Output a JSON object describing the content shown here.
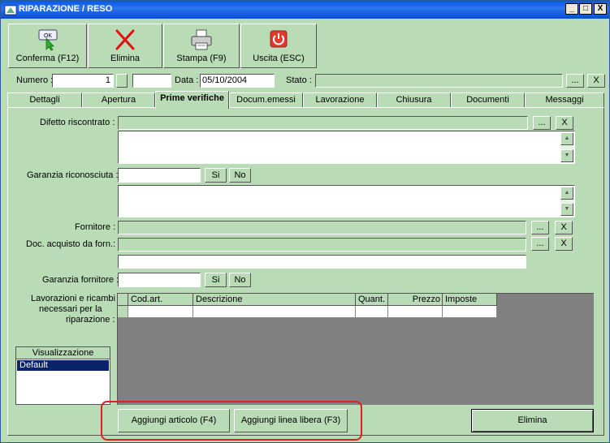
{
  "window": {
    "title": "RIPARAZIONE / RESO",
    "minimize": "_",
    "maximize": "□",
    "close": "X"
  },
  "toolbar": [
    {
      "label": "Conferma (F12)",
      "icon": "ok-cursor-icon"
    },
    {
      "label": "Elimina",
      "icon": "red-x-icon"
    },
    {
      "label": "Stampa (F9)",
      "icon": "printer-icon"
    },
    {
      "label": "Uscita (ESC)",
      "icon": "power-icon"
    }
  ],
  "header": {
    "numero_label": "Numero :",
    "numero_value": "1",
    "data_label": "Data :",
    "data_value": "05/10/2004",
    "stato_label": "Stato :",
    "lookup": "...",
    "clear": "X"
  },
  "tabs": [
    "Dettagli",
    "Apertura",
    "Prime verifiche",
    "Docum.emessi",
    "Lavorazione",
    "Chiusura",
    "Documenti",
    "Messaggi"
  ],
  "active_tab": "Prime verifiche",
  "form": {
    "difetto_label": "Difetto riscontrato :",
    "garanzia_label": "Garanzia riconosciuta :",
    "si": "Si",
    "no": "No",
    "fornitore_label": "Fornitore :",
    "doc_acquisto_label": "Doc. acquisto da forn.:",
    "garanzia_fornitore_label": "Garanzia fornitore :",
    "lavorazioni_label_1": "Lavorazioni e ricambi",
    "lavorazioni_label_2": "necessari per la",
    "lavorazioni_label_3": "riparazione :",
    "lookup": "...",
    "clear": "X"
  },
  "grid": {
    "columns": [
      "Cod.art.",
      "Descrizione",
      "Quant.",
      "Prezzo",
      "Imposte"
    ]
  },
  "visualizzazione": {
    "title": "Visualizzazione",
    "items": [
      "Default"
    ]
  },
  "buttons": {
    "aggiungi_articolo": "Aggiungi articolo (F4)",
    "aggiungi_linea": "Aggiungi linea libera (F3)",
    "elimina": "Elimina"
  },
  "colors": {
    "background": "#b9dcb7",
    "highlight": "#e02020",
    "titlebar": "#0a58e0",
    "selection": "#0a246a"
  }
}
